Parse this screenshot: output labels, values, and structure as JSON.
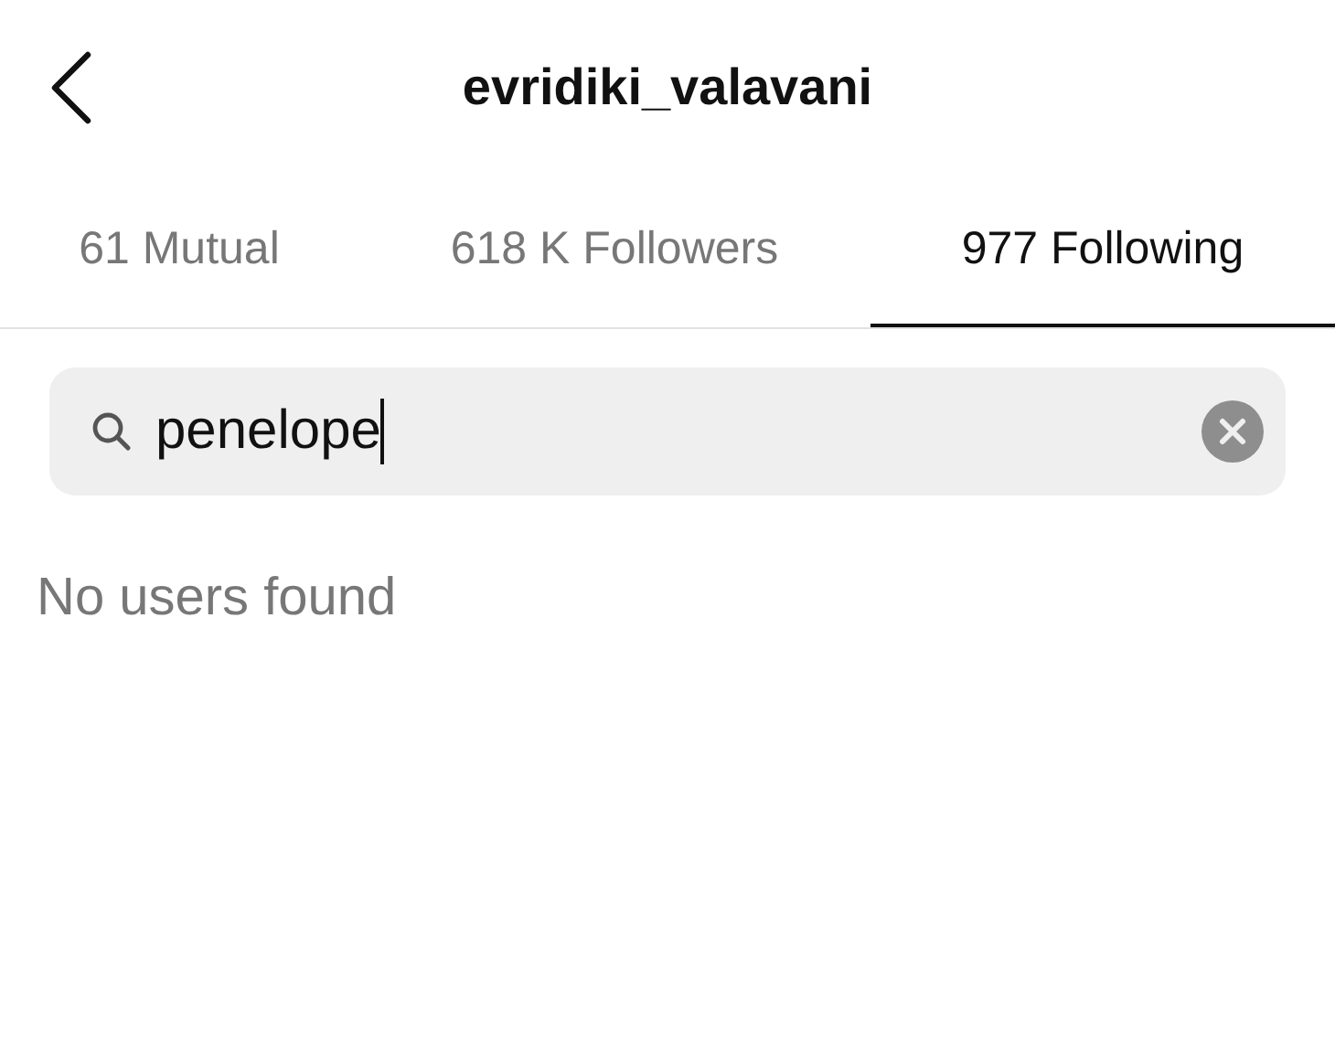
{
  "header": {
    "title": "evridiki_valavani"
  },
  "tabs": [
    {
      "label": "61 Mutual",
      "selected": false
    },
    {
      "label": "618 K Followers",
      "selected": false
    },
    {
      "label": "977 Following",
      "selected": true
    }
  ],
  "search": {
    "value": "penelope"
  },
  "message": "No users found"
}
